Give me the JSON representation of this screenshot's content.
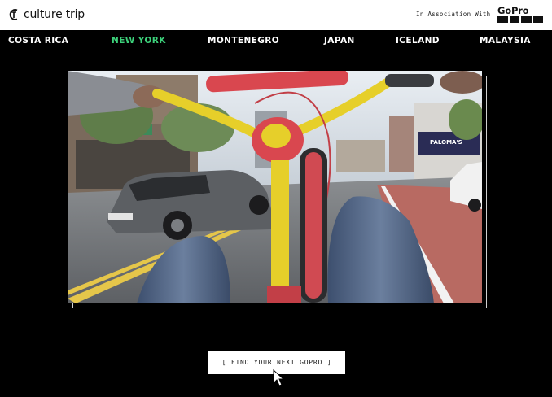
{
  "header": {
    "logo_text": "culture trip",
    "association_text": "In Association With",
    "partner_logo_text": "GoPro"
  },
  "nav": {
    "items": [
      {
        "label": "COSTA RICA",
        "active": false
      },
      {
        "label": "NEW YORK",
        "active": true
      },
      {
        "label": "MONTENEGRO",
        "active": false
      },
      {
        "label": "JAPAN",
        "active": false
      },
      {
        "label": "ICELAND",
        "active": false
      },
      {
        "label": "MALAYSIA",
        "active": false
      }
    ]
  },
  "video": {
    "storefront_sign": "PALOMA'S"
  },
  "cta": {
    "label": "[ FIND YOUR NEXT GOPRO ]"
  },
  "colors": {
    "active_nav": "#3cd07a",
    "background": "#000000",
    "header_bg": "#ffffff"
  }
}
